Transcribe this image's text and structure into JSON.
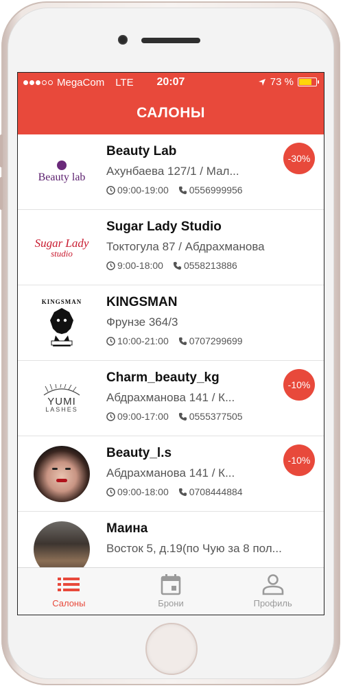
{
  "status_bar": {
    "carrier": "MegaCom",
    "network": "LTE",
    "time": "20:07",
    "battery": "73 %",
    "battery_level": 0.73
  },
  "header": {
    "title": "САЛОНЫ"
  },
  "salons": [
    {
      "name": "Beauty Lab",
      "address": "Ахунбаева 127/1 / Мал...",
      "hours": "09:00-19:00",
      "phone": "0556999956",
      "discount": "-30%",
      "logo_text": "Beauty lab"
    },
    {
      "name": "Sugar Lady Studio",
      "address": "Токтогула 87 / Абдрахманова",
      "hours": "9:00-18:00",
      "phone": "0558213886",
      "discount": "",
      "logo_text": "Sugar Lady",
      "logo_subtext": "studio"
    },
    {
      "name": "KINGSMAN",
      "address": "Фрунзе 364/3",
      "hours": "10:00-21:00",
      "phone": "0707299699",
      "discount": "",
      "logo_text": "KINGSMAN"
    },
    {
      "name": "Charm_beauty_kg",
      "address": "Абдрахманова 141 / К...",
      "hours": "09:00-17:00",
      "phone": "0555377505",
      "discount": "-10%",
      "logo_text": "YUMI",
      "logo_subtext": "LASHES"
    },
    {
      "name": "Beauty_l.s",
      "address": "Абдрахманова 141 / К...",
      "hours": "09:00-18:00",
      "phone": "0708444884",
      "discount": "-10%"
    },
    {
      "name": "Маина",
      "address": "Восток 5, д.19(по Чую за 8 пол...",
      "hours": "",
      "phone": "",
      "discount": ""
    }
  ],
  "tabs": [
    {
      "label": "Салоны",
      "icon": "list-icon",
      "active": true
    },
    {
      "label": "Брони",
      "icon": "calendar-icon",
      "active": false
    },
    {
      "label": "Профиль",
      "icon": "person-icon",
      "active": false
    }
  ],
  "colors": {
    "accent": "#e8493b"
  }
}
